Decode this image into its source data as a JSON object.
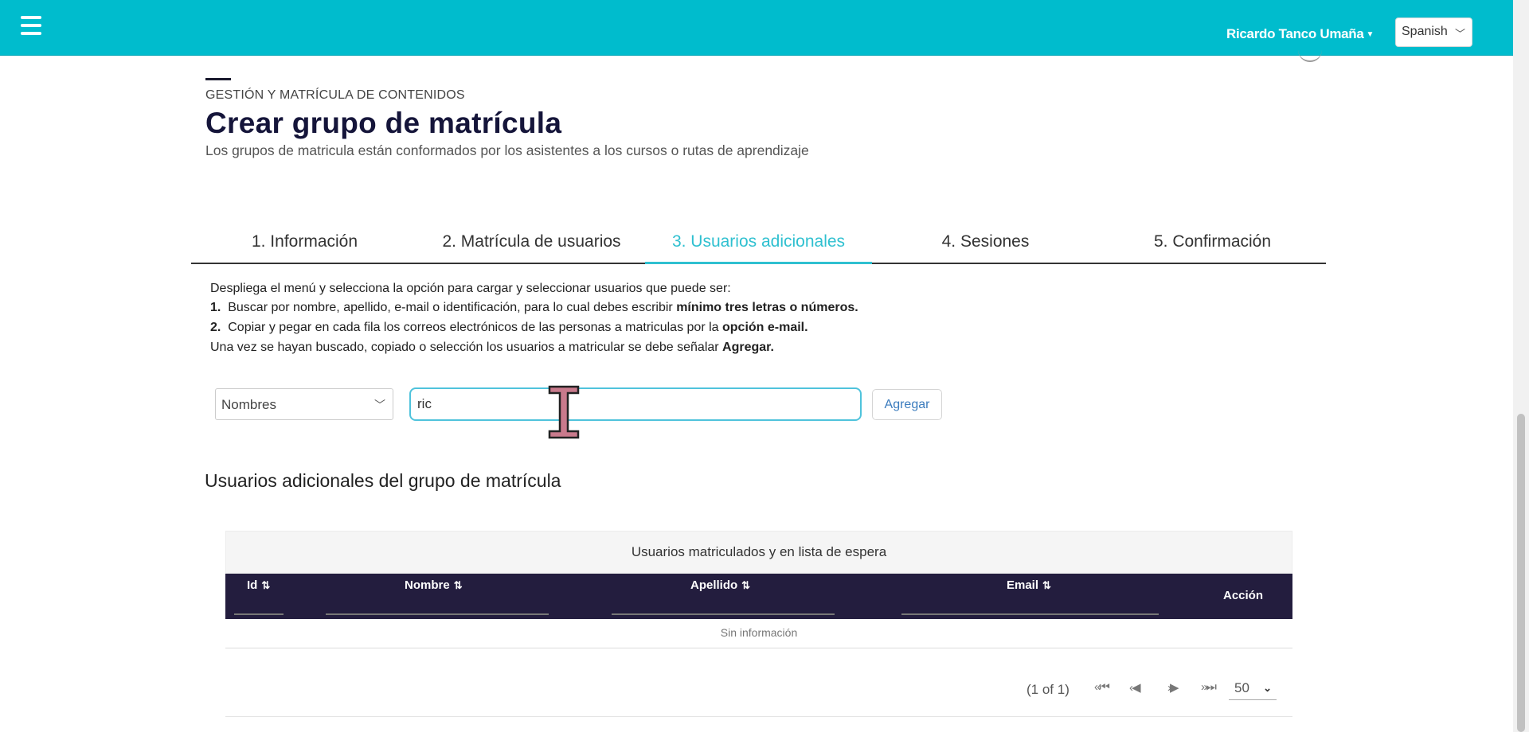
{
  "header": {
    "user_name": "Ricardo Tanco Umaña",
    "language": "Spanish",
    "menu_icon": "hamburger-icon",
    "accent_color": "#00bccd"
  },
  "page": {
    "overline": "GESTIÓN Y MATRÍCULA DE CONTENIDOS",
    "title": "Crear grupo de matrícula",
    "subtitle": "Los grupos de matricula están conformados por los asistentes a los cursos o rutas de aprendizaje"
  },
  "tabs": [
    {
      "label": "1. Información",
      "active": false
    },
    {
      "label": "2. Matrícula de usuarios",
      "active": false
    },
    {
      "label": "3. Usuarios adicionales",
      "active": true
    },
    {
      "label": "4. Sesiones",
      "active": false
    },
    {
      "label": "5. Confirmación",
      "active": false
    }
  ],
  "instructions": {
    "intro": "Despliega el menú y selecciona la opción para cargar y seleccionar usuarios que puede ser:",
    "item1_num": "1.",
    "item1_text": "Buscar por nombre, apellido, e-mail o identificación, para lo cual debes escribir ",
    "item1_bold": "mínimo tres letras o números.",
    "item2_num": "2.",
    "item2_text": "Copiar y pegar en cada fila los correos electrónicos de las personas a matriculas por la ",
    "item2_bold": "opción e-mail.",
    "outro_text": "Una vez se hayan buscado, copiado o selección los usuarios a matricular se debe señalar ",
    "outro_bold": "Agregar."
  },
  "search": {
    "filter_value": "Nombres",
    "input_value": "ric",
    "add_label": "Agregar"
  },
  "section": {
    "title": "Usuarios adicionales del grupo de matrícula"
  },
  "table": {
    "caption": "Usuarios matriculados y en lista de espera",
    "columns": [
      "Id",
      "Nombre",
      "Apellido",
      "Email",
      "Acción"
    ],
    "empty_message": "Sin información"
  },
  "pagination": {
    "status": "(1 of 1)",
    "rows_per_page": "50"
  }
}
